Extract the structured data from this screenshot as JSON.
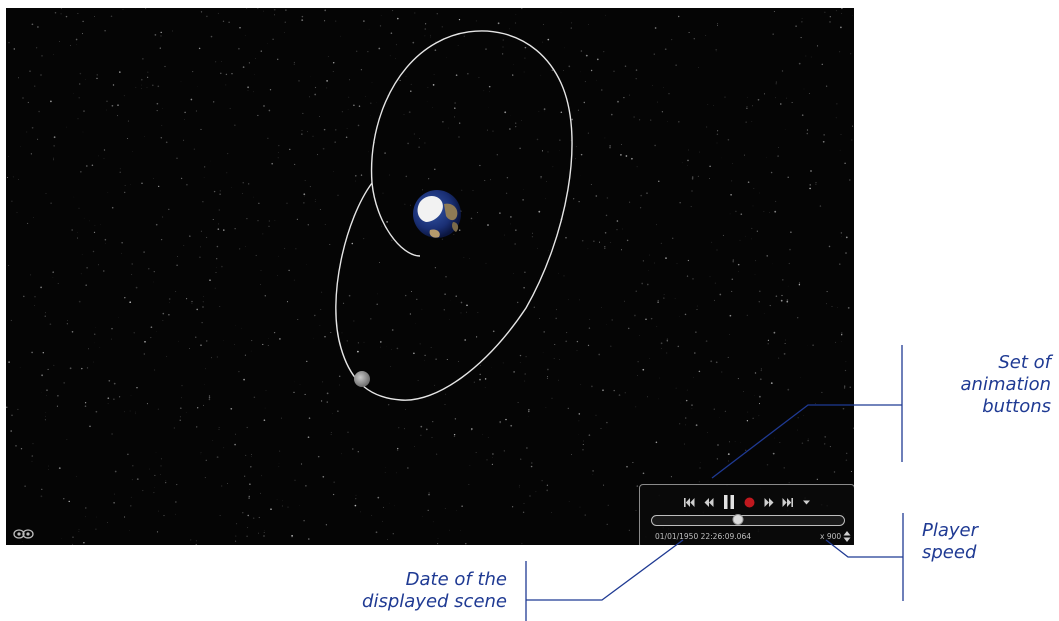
{
  "scene": {
    "background_color": "#050505",
    "orbit_color": "#e6e6e6",
    "planet_icon": "earth-globe",
    "satellite_icon": "grey-sphere",
    "logo_icon": "eye-logo"
  },
  "player": {
    "buttons": [
      {
        "name": "skip-to-start",
        "icon": "skip-start-icon"
      },
      {
        "name": "step-back",
        "icon": "rewind-icon"
      },
      {
        "name": "pause",
        "icon": "pause-icon"
      },
      {
        "name": "record",
        "icon": "record-icon"
      },
      {
        "name": "step-forward",
        "icon": "fast-forward-icon"
      },
      {
        "name": "skip-to-end",
        "icon": "skip-end-icon"
      },
      {
        "name": "options",
        "icon": "chevron-down-icon"
      }
    ],
    "timeline_position": 0.45,
    "date": "01/01/1950 22:26:09.064",
    "speed": "x 900",
    "record_color": "#c0181e"
  },
  "annotations": {
    "color": "#1f3a93",
    "buttons_note": [
      "Set of",
      "animation",
      "buttons"
    ],
    "speed_note": [
      "Player",
      "speed"
    ],
    "date_note": [
      "Date of the",
      "displayed scene"
    ]
  }
}
